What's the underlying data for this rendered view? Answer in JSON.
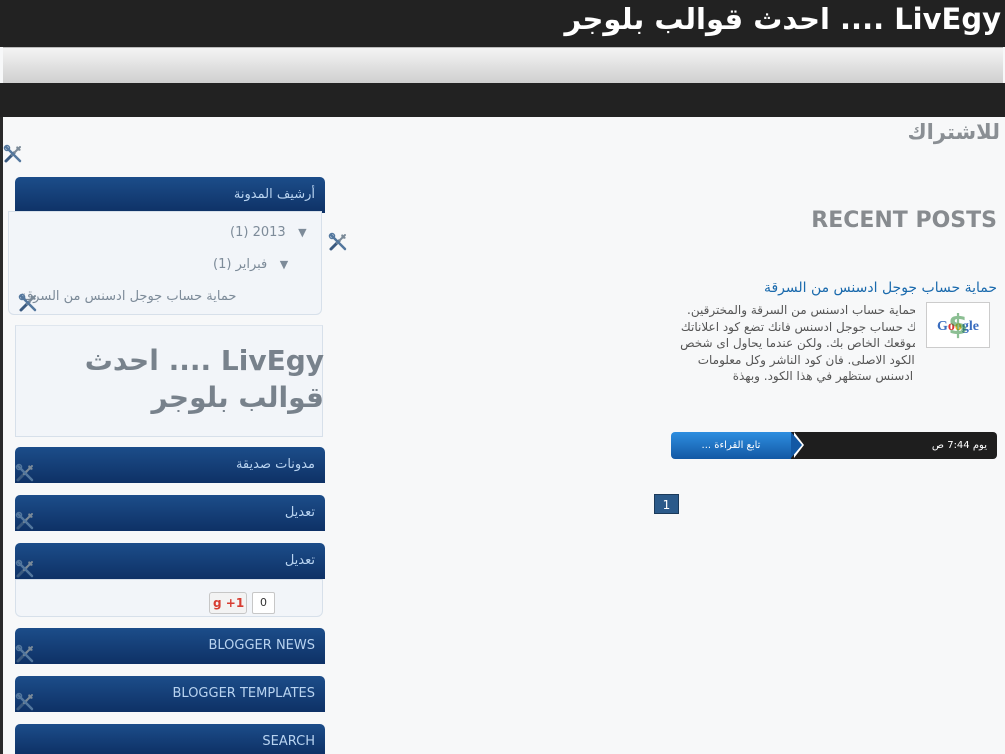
{
  "header": {
    "site_title": "LivEgy .... احدث قوالب بلوجر"
  },
  "main": {
    "subscribe_title": "للاشتراك",
    "recent_posts_title": "RECENT POSTS",
    "post": {
      "title": "حماية حساب جوجل ادسنس من السرقة",
      "snippet": "سنرى طريقة لحماية حساب ادسنس من السرقة والمخترقين. عندما يكون لديك حساب جوجل ادسنس فانك تضع كود اعلاناتك في مدونتك او موقعك الخاص بك. ولكن عندما يحاول اى شخص ان يحصل على الكود الاصلى. فان كود الناشر وكل معلومات حسابك لجوجل ادسنس ستظهر في هذا الكود. وبهذة",
      "time": "يوم 7:44 ص",
      "read_more": "تابع القراءة ...",
      "thumb_text": "Google"
    },
    "pagination": {
      "current": "1"
    }
  },
  "sidebar": {
    "archive": {
      "title": "أرشيف المدونة",
      "year": "2013 (1)",
      "month": "فبراير (1)",
      "post": "حماية حساب جوجل ادسنس من السرقة",
      "tri": "▼"
    },
    "header_widget": {
      "text": "LivEgy .... احدث قوالب بلوجر"
    },
    "friends": {
      "title": "مدونات صديقة"
    },
    "edit1": {
      "title": "تعديل"
    },
    "edit2": {
      "title": "تعديل"
    },
    "gplus": {
      "g": "g",
      "label": "+1",
      "count": "0"
    },
    "blogger_news": {
      "title": "BLOGGER NEWS"
    },
    "blogger_templates": {
      "title": "BLOGGER TEMPLATES"
    },
    "search": {
      "title": "SEARCH"
    }
  },
  "icons": {
    "tool": "wrench-screwdriver-icon"
  },
  "colors": {
    "header_bg": "#222222",
    "widget_head": "#0e3166",
    "link": "#1a6aad",
    "muted": "#7d8b99"
  }
}
